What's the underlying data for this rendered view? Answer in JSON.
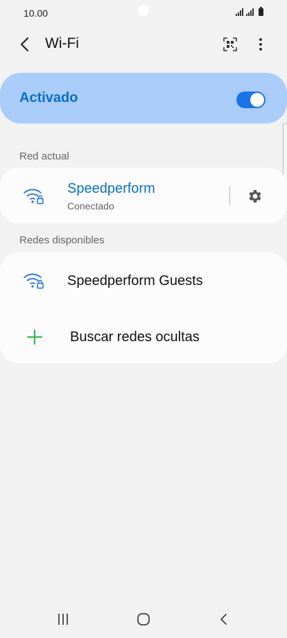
{
  "status_bar": {
    "time": "10.00"
  },
  "app_bar": {
    "title": "Wi-Fi"
  },
  "wifi_toggle": {
    "label": "Activado",
    "state": "on",
    "accent_color": "#1a73e8",
    "background_color": "#a9cdf8"
  },
  "current_network": {
    "section_title": "Red actual",
    "name": "Speedperform",
    "status": "Conectado",
    "name_color": "#0a6fc6",
    "icon": "wifi-locked-icon"
  },
  "available_networks": {
    "section_title": "Redes disponibles",
    "items": [
      {
        "name": "Speedperform Guests",
        "icon": "wifi-locked-icon"
      }
    ],
    "add_hidden_label": "Buscar redes ocultas",
    "add_icon_color": "#2db34a"
  },
  "nav_bar": {
    "recents_icon": "recents-icon",
    "home_icon": "home-icon",
    "back_icon": "back-icon"
  }
}
